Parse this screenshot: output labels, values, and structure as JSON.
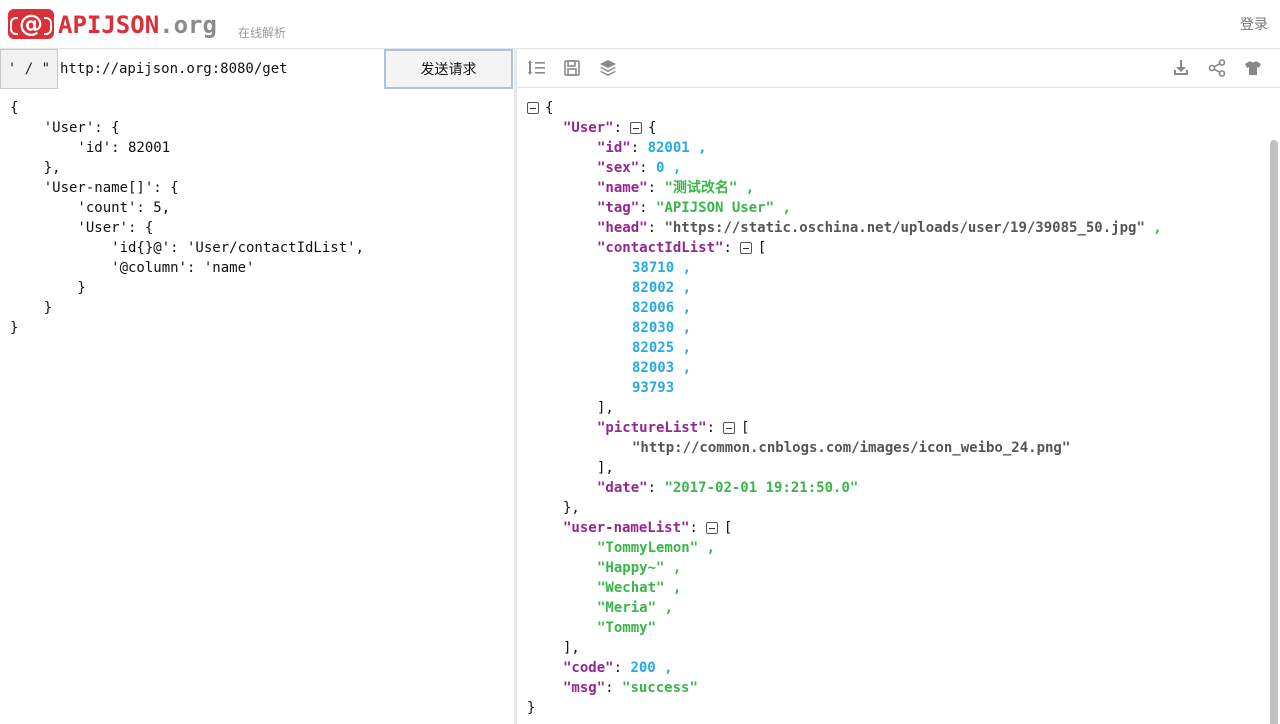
{
  "header": {
    "logo_symbol": "@",
    "logo_main": "APIJSON",
    "logo_suffix": ".org",
    "subtitle": "在线解析",
    "login": "登录"
  },
  "request": {
    "quote_toggle": "' / \"",
    "url": "http://apijson.org:8080/get",
    "send_label": "发送请求",
    "body_lines": [
      "{",
      "    'User': {",
      "        'id': 82001",
      "    },",
      "    'User-name[]': {",
      "        'count': 5,",
      "        'User': {",
      "            'id{}@': 'User/contactIdList',",
      "            '@column': 'name'",
      "        }",
      "    }",
      "}"
    ]
  },
  "toolbar": {
    "icons": [
      "format-list-icon",
      "save-icon",
      "layers-icon",
      "download-icon",
      "share-icon",
      "theme-shirt-icon"
    ]
  },
  "response": {
    "user_key": "\"User\"",
    "id_key": "\"id\"",
    "id_val": "82001",
    "sex_key": "\"sex\"",
    "sex_val": "0",
    "name_key": "\"name\"",
    "name_val": "\"测试改名\"",
    "tag_key": "\"tag\"",
    "tag_val": "\"APIJSON User\"",
    "head_key": "\"head\"",
    "head_val": "\"https://static.oschina.net/uploads/user/19/39085_50.jpg\"",
    "contact_key": "\"contactIdList\"",
    "contact_ids": [
      "38710",
      "82002",
      "82006",
      "82030",
      "82025",
      "82003",
      "93793"
    ],
    "picture_key": "\"pictureList\"",
    "picture_val": "\"http://common.cnblogs.com/images/icon_weibo_24.png\"",
    "date_key": "\"date\"",
    "date_val": "\"2017-02-01 19:21:50.0\"",
    "namelist_key": "\"user-nameList\"",
    "names": [
      "\"TommyLemon\"",
      "\"Happy~\"",
      "\"Wechat\"",
      "\"Meria\"",
      "\"Tommy\""
    ],
    "code_key": "\"code\"",
    "code_val": "200",
    "msg_key": "\"msg\"",
    "msg_val": "\"success\""
  },
  "colors": {
    "brand": "#d9303a",
    "key": "#92278f",
    "string": "#3ab54a",
    "number": "#25aae2"
  }
}
